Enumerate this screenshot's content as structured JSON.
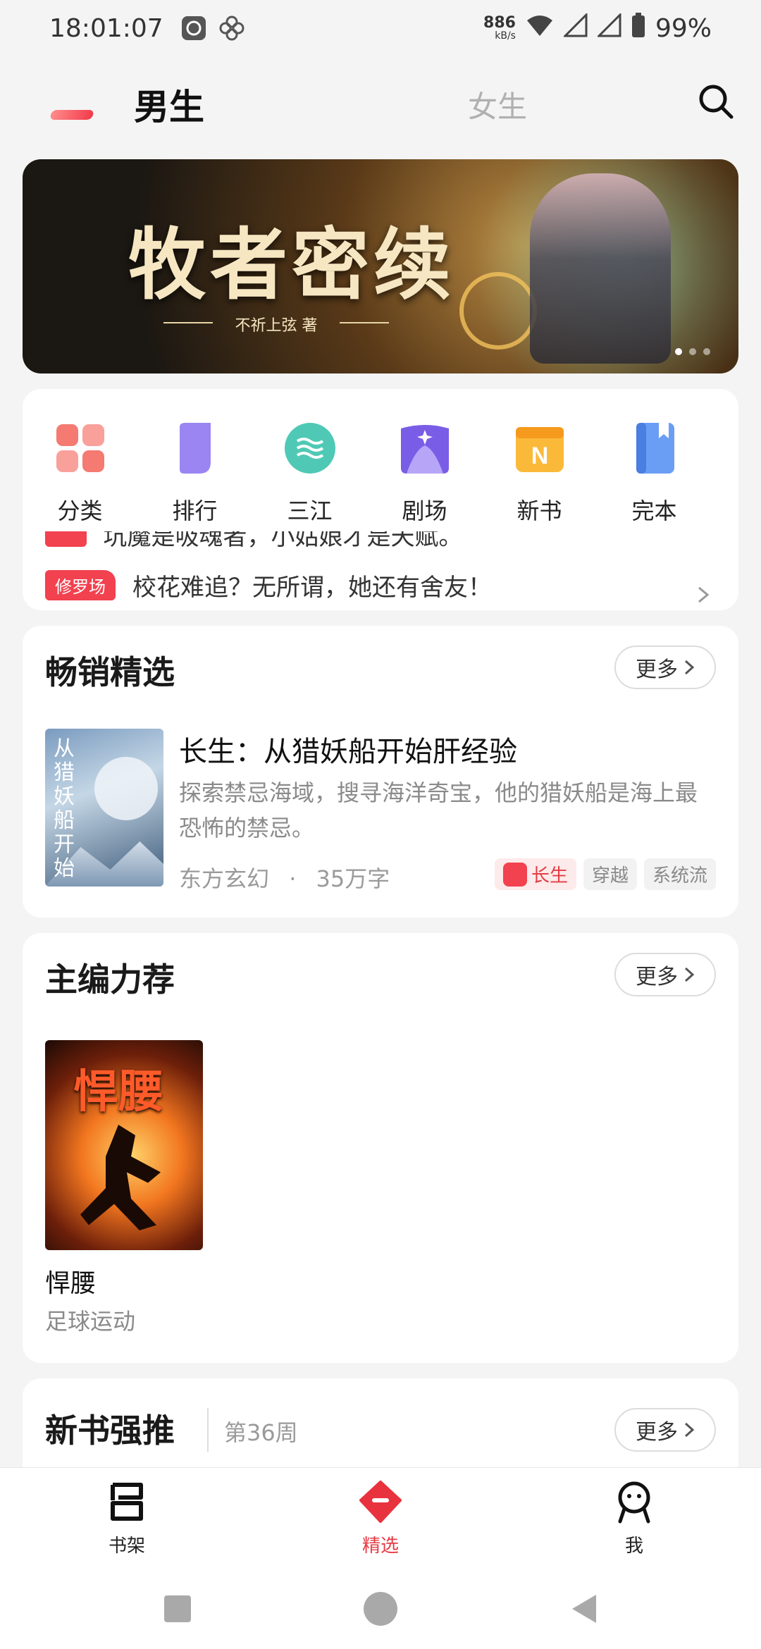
{
  "status_bar": {
    "time": "18:01:07",
    "net_speed": "886",
    "net_unit": "kB/s",
    "battery": "99%"
  },
  "top_tabs": {
    "male": "男生",
    "female": "女生",
    "active_color": "#f23a4a"
  },
  "banner": {
    "title": "牧者密续",
    "author": "不祈上弦 著"
  },
  "categories": [
    {
      "label": "分类",
      "icon": "grid-icon"
    },
    {
      "label": "排行",
      "icon": "bookmark-icon"
    },
    {
      "label": "三江",
      "icon": "wave-icon"
    },
    {
      "label": "剧场",
      "icon": "theater-icon"
    },
    {
      "label": "新书",
      "icon": "new-book-icon"
    },
    {
      "label": "完本",
      "icon": "book-icon"
    }
  ],
  "ticker": {
    "prev_text": "坑魔是吸魂者，小姑娘才是天赋。",
    "tag": "修罗场",
    "text": "校花难追？无所谓，她还有舍友！"
  },
  "bestseller": {
    "title": "畅销精选",
    "more": "更多",
    "book": {
      "cover_title": "从猎妖船开始",
      "title": "长生：从猎妖船开始肝经验",
      "desc": "探索禁忌海域，搜寻海洋奇宝，他的猎妖船是海上最恐怖的禁忌。",
      "genre": "东方玄幻",
      "dot": "·",
      "words": "35万字",
      "tags": [
        "长生",
        "穿越",
        "系统流"
      ]
    }
  },
  "editor_picks": {
    "title": "主编力荐",
    "more": "更多",
    "book": {
      "cover_title": "悍腰",
      "title": "悍腰",
      "category": "足球运动"
    }
  },
  "new_books": {
    "title": "新书强推",
    "week": "第36周",
    "more": "更多"
  },
  "bottom_nav": [
    {
      "label": "书架",
      "icon": "bookshelf-icon",
      "active": false
    },
    {
      "label": "精选",
      "icon": "featured-icon",
      "active": true
    },
    {
      "label": "我",
      "icon": "profile-icon",
      "active": false
    }
  ]
}
